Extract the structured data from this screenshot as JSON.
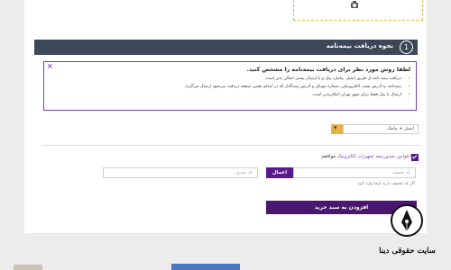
{
  "section": {
    "number": "1",
    "title": "نحوه دریافت بیمه‌نامه"
  },
  "notice": {
    "close": "×",
    "headline": "لطفا روش مورد نظر برای دریافت بیمه‌نامه را مشخص کنید.",
    "items": [
      "دریافت بیمه نامه از طریق ایمیل، پیامک، پیک و یا ارسال پستی امکان پذیر است.",
      "بیمه‌نامه به آدرس پست الکترونیکی، شماره موبایل و آدرس بیمه‌گذار که در ابتدای همین صفحه دریافت می‌شود ارسال می‌گردد.",
      "ارسال با پیک فقط برای شهر تهران امکان‌پذیر است."
    ]
  },
  "delivery_select": {
    "value": "ایمیل + پیامک",
    "chevron": "▾"
  },
  "terms": {
    "prefix": "با",
    "link": "قوانین صدوربیمه تجهیزات الکترونیک",
    "suffix": "موافقم"
  },
  "coupon": {
    "placeholder": "کد تخفیف",
    "apply_label": "اعمال",
    "referral_placeholder": "کد معرف",
    "hint": "اگر کد تخفیف دارید اینجا وارد کنید"
  },
  "add_to_cart": "افزودن به سبد خرید",
  "logo": {
    "text": "سایت حقوقی دینا"
  },
  "colors": {
    "section_bar": "#3c4858",
    "accent_purple": "#5a1a8c",
    "accent_yellow": "#e8b341"
  }
}
